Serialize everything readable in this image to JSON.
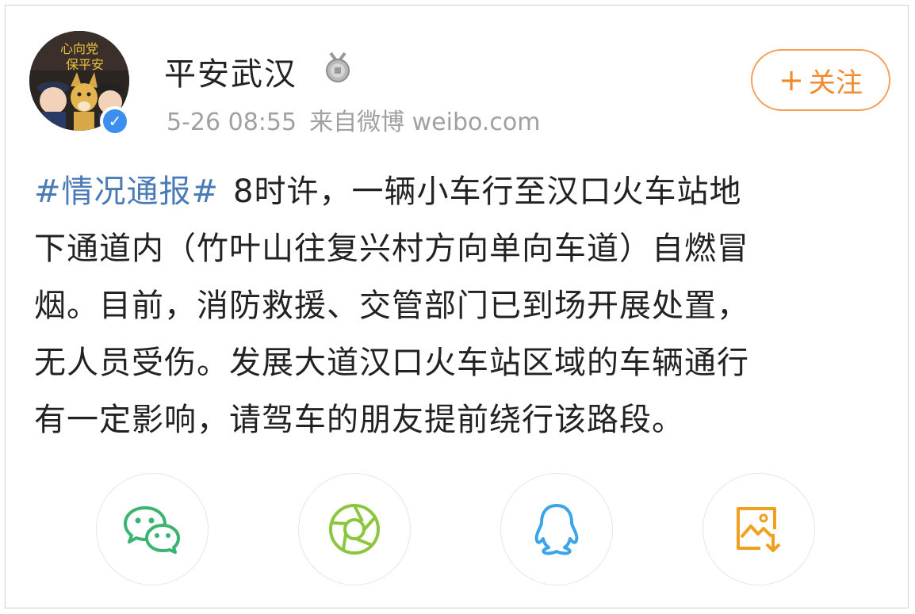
{
  "post": {
    "author": "平安武汉",
    "timestamp": "5-26 08:55",
    "source": "来自微博 weibo.com",
    "follow_label": "关注",
    "follow_plus": "+",
    "avatar_text": [
      "心向党",
      "保平安"
    ],
    "verified_mark": "✓",
    "hashtag": "#情况通报#",
    "content_lines": [
      "8时许，一辆小车行至汉口火车站地",
      "下通道内（竹叶山往复兴村方向单向车道）自燃冒",
      "烟。目前，消防救援、交管部门已到场开展处置，",
      "无人员受伤。发展大道汉口火车站区域的车辆通行",
      "有一定影响，请驾车的朋友提前绕行该路段。"
    ]
  },
  "share": [
    {
      "icon": "wechat-icon",
      "color": "#3cb371"
    },
    {
      "icon": "moments-icon",
      "color": "#8cc63f"
    },
    {
      "icon": "qq-icon",
      "color": "#3ba5e8"
    },
    {
      "icon": "save-image-icon",
      "color": "#f0a020"
    }
  ],
  "colors": {
    "hashtag": "#4a7bb7",
    "follow": "#f08a2c",
    "meta": "#a0a0a0",
    "verified": "#3c8eef"
  }
}
